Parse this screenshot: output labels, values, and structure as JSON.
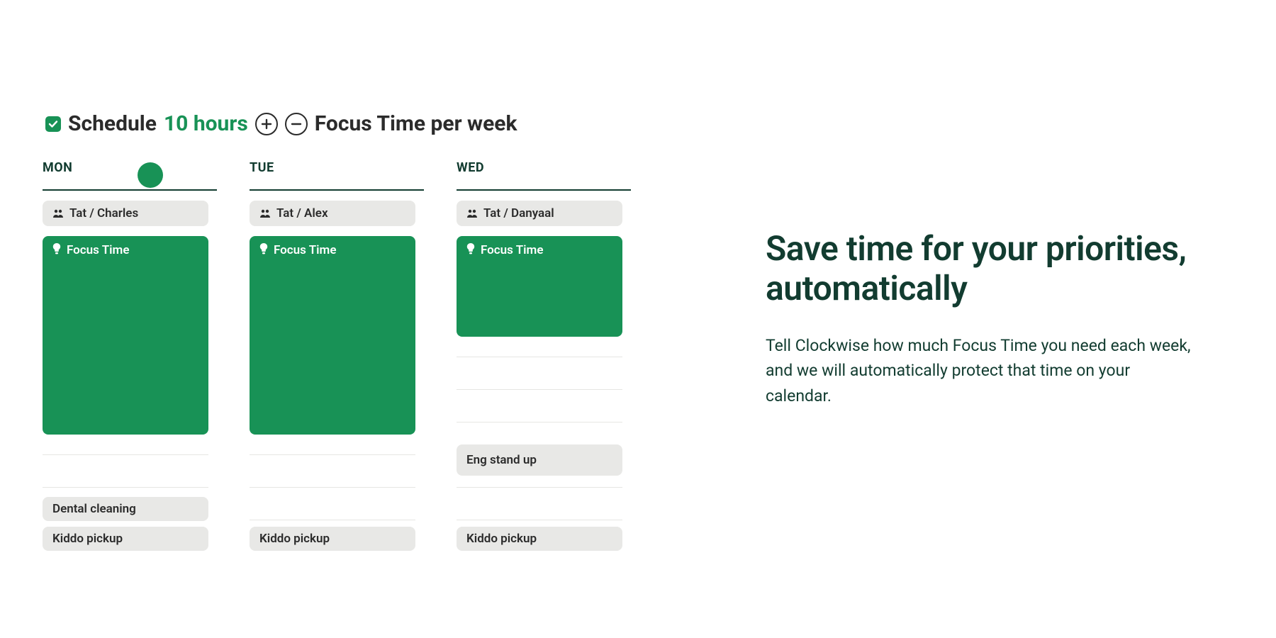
{
  "control": {
    "label_schedule": "Schedule",
    "hours_text": "10 hours",
    "label_focus_per_week": "Focus Time per week"
  },
  "calendar": {
    "days": [
      {
        "header": "MON",
        "events": [
          {
            "kind": "meeting",
            "label": "Tat / Charles"
          },
          {
            "kind": "focus",
            "label": "Focus Time"
          },
          {
            "kind": "plain",
            "label": "Dental cleaning"
          },
          {
            "kind": "plain",
            "label": "Kiddo pickup"
          }
        ]
      },
      {
        "header": "TUE",
        "events": [
          {
            "kind": "meeting",
            "label": "Tat / Alex"
          },
          {
            "kind": "focus",
            "label": "Focus Time"
          },
          {
            "kind": "plain",
            "label": "Kiddo pickup"
          }
        ]
      },
      {
        "header": "WED",
        "events": [
          {
            "kind": "meeting",
            "label": "Tat / Danyaal"
          },
          {
            "kind": "focus",
            "label": "Focus Time"
          },
          {
            "kind": "plain",
            "label": "Eng stand up"
          },
          {
            "kind": "plain",
            "label": "Kiddo pickup"
          }
        ]
      }
    ]
  },
  "copy": {
    "heading": "Save time for your priorities, automatically",
    "body": "Tell Clockwise how much Focus Time you need each week, and we will automatically protect that time on your calendar."
  },
  "colors": {
    "accent": "#189256",
    "dark": "#123c30",
    "gray_bg": "#e8e8e6"
  }
}
